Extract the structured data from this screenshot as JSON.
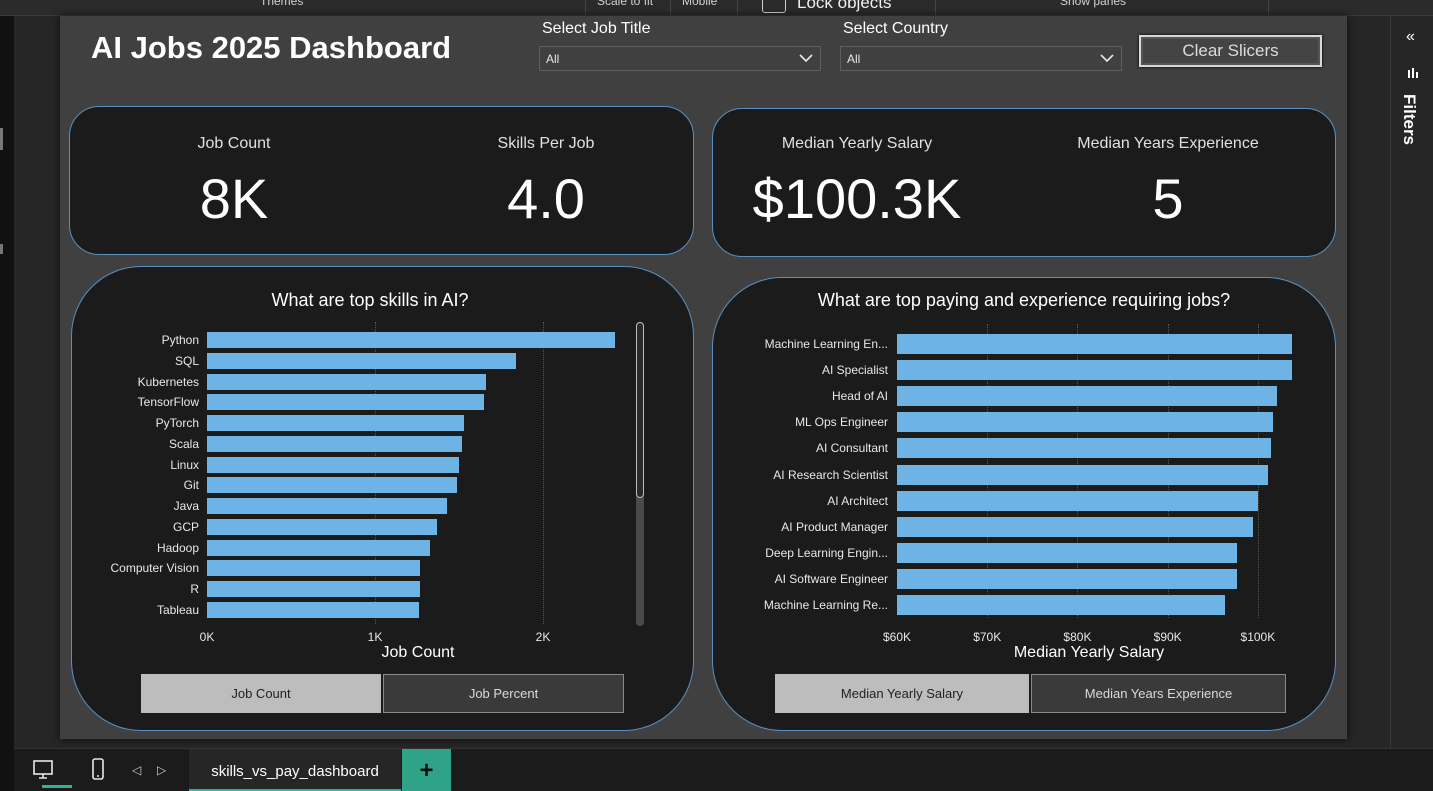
{
  "ribbon": {
    "themes": "Themes",
    "scale_to_fit": "Scale to fit",
    "mobile": "Mobile",
    "lock_objects": "Lock objects",
    "show_panes": "Show panes"
  },
  "dashboard": {
    "title": "AI Jobs 2025 Dashboard",
    "slicer_job_title": {
      "label": "Select Job Title",
      "value": "All"
    },
    "slicer_country": {
      "label": "Select Country",
      "value": "All"
    },
    "clear_button": "Clear Slicers"
  },
  "kpis": [
    {
      "label": "Job Count",
      "value": "8K"
    },
    {
      "label": "Skills Per Job",
      "value": "4.0"
    },
    {
      "label": "Median Yearly Salary",
      "value": "$100.3K"
    },
    {
      "label": "Median Years Experience",
      "value": "5"
    }
  ],
  "skills_chart_toggles": {
    "active": "Job Count",
    "inactive": "Job Percent"
  },
  "pay_chart_toggles": {
    "active": "Median Yearly Salary",
    "inactive": "Median Years Experience"
  },
  "filters_pane": {
    "label": "Filters"
  },
  "bottom_bar": {
    "page_tab": "skills_vs_pay_dashboard",
    "add_page": "+"
  },
  "colors": {
    "bar": "#6eb3e6",
    "accent": "#2fb39c",
    "card_border": "#5a8fc0"
  },
  "chart_data": [
    {
      "type": "bar",
      "orientation": "horizontal",
      "title": "What are top skills in AI?",
      "xlabel": "Job Count",
      "ylabel": "",
      "categories": [
        "Python",
        "SQL",
        "Kubernetes",
        "TensorFlow",
        "PyTorch",
        "Scala",
        "Linux",
        "Git",
        "Java",
        "GCP",
        "Hadoop",
        "Computer Vision",
        "R",
        "Tableau"
      ],
      "values": [
        2430,
        1840,
        1660,
        1650,
        1530,
        1520,
        1500,
        1490,
        1430,
        1370,
        1330,
        1270,
        1270,
        1260
      ],
      "xlim": [
        0,
        2500
      ],
      "x_ticks": [
        0,
        1000,
        2000
      ],
      "x_tick_labels": [
        "0K",
        "1K",
        "2K"
      ],
      "grid": true
    },
    {
      "type": "bar",
      "orientation": "horizontal",
      "title": "What are top paying and experience requiring jobs?",
      "xlabel": "Median Yearly Salary",
      "ylabel": "",
      "categories": [
        "Machine Learning En...",
        "AI Specialist",
        "Head of AI",
        "ML Ops Engineer",
        "AI Consultant",
        "AI Research Scientist",
        "AI Architect",
        "AI Product Manager",
        "Deep Learning Engin...",
        "AI Software Engineer",
        "Machine Learning Re..."
      ],
      "values": [
        103800,
        103750,
        102100,
        101700,
        101500,
        101100,
        100000,
        99500,
        97700,
        97700,
        96300
      ],
      "xlim": [
        60000,
        105000
      ],
      "x_ticks": [
        60000,
        70000,
        80000,
        90000,
        100000
      ],
      "x_tick_labels": [
        "$60K",
        "$70K",
        "$80K",
        "$90K",
        "$100K"
      ],
      "grid": true
    }
  ]
}
